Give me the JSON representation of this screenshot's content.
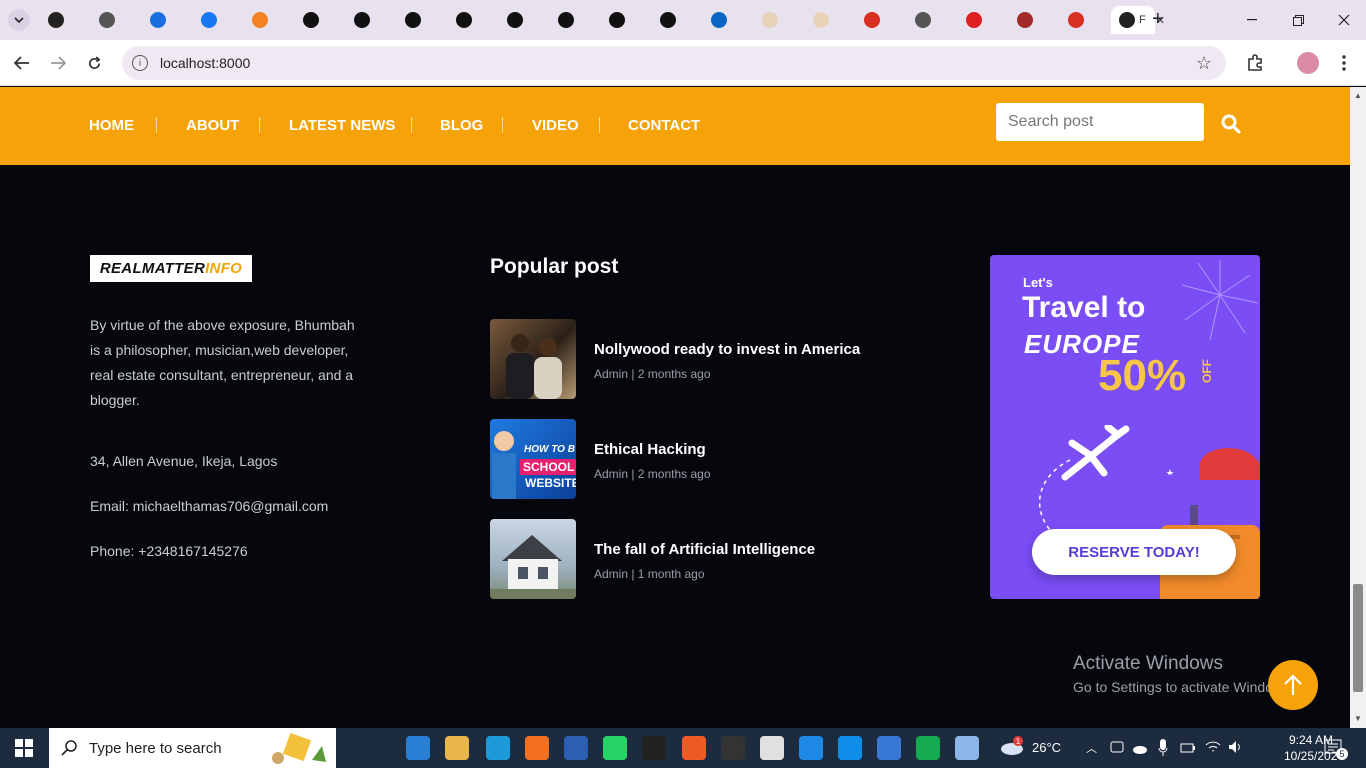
{
  "browser": {
    "tab_count": 22,
    "active_tab_label": "F",
    "url": "localhost:8000",
    "new_tab_symbol": "+"
  },
  "site": {
    "nav": [
      "HOME",
      "ABOUT",
      "LATEST NEWS",
      "BLOG",
      "VIDEO",
      "CONTACT"
    ],
    "search_placeholder": "Search post",
    "logo_part1": "REALMATTER",
    "logo_part2": "INFO",
    "about_text": "By virtue of the above exposure, Bhumbah is a philosopher, musician,web developer, real estate consultant, entrepreneur, and a blogger.",
    "address": "34, Allen Avenue, Ikeja, Lagos",
    "email": "Email: michaelthamas706@gmail.com",
    "phone": "Phone: +2348167145276",
    "popular_title": "Popular post",
    "posts": [
      {
        "title": "Nollywood ready to invest in America",
        "meta": "Admin | 2 months ago"
      },
      {
        "title": "Ethical Hacking",
        "meta": "Admin | 2 months ago"
      },
      {
        "title": "The fall of Artificial Intelligence",
        "meta": "Admin | 1 month ago"
      }
    ],
    "ad": {
      "lets": "Let's",
      "travel": "Travel to",
      "europe": "EUROPE",
      "percent": "50%",
      "off": "OFF",
      "button": "RESERVE TODAY!",
      "thumb2_line1": "HOW TO B",
      "thumb2_line2": "SCHOOL",
      "thumb2_line3": "WEBSITE"
    }
  },
  "watermark": {
    "line1": "Activate Windows",
    "line2": "Go to Settings to activate Windows."
  },
  "taskbar": {
    "search_placeholder": "Type here to search",
    "weather": "26°C",
    "time": "9:24 AM",
    "date": "10/25/2024",
    "notification_count": "5",
    "weather_badge": "1"
  },
  "colors": {
    "accent": "#f5a308",
    "footer_bg": "#05070d",
    "ad_bg": "#7a4df5"
  }
}
